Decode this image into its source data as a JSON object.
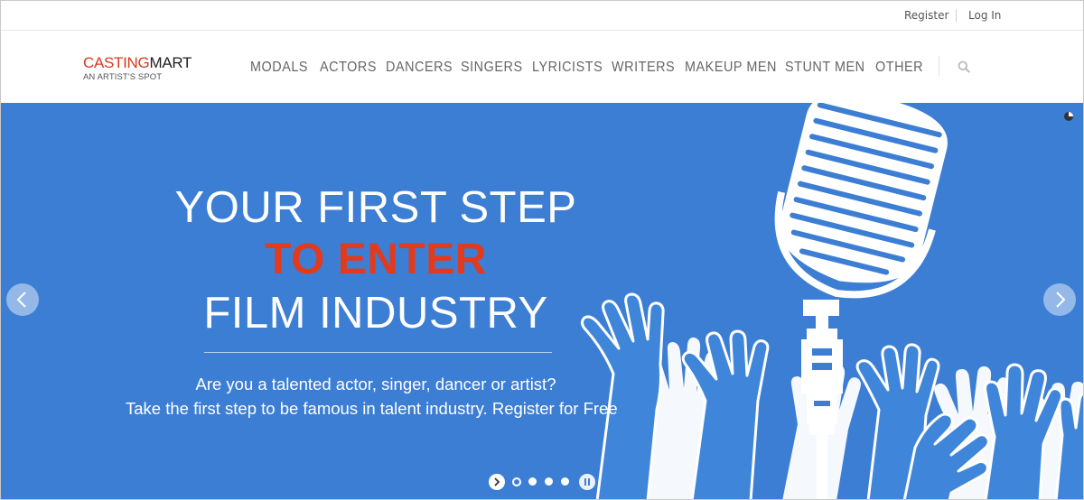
{
  "topbar": {
    "register_label": "Register",
    "login_label": "Log In"
  },
  "brand": {
    "name_part1": "CASTING",
    "name_part2": "MART",
    "tagline": "AN ARTIST'S SPOT",
    "accent_color": "#d9381e"
  },
  "nav": {
    "items": [
      {
        "label": "MODALS"
      },
      {
        "label": "ACTORS"
      },
      {
        "label": "DANCERS"
      },
      {
        "label": "SINGERS"
      },
      {
        "label": "LYRICISTS"
      },
      {
        "label": "WRITERS"
      },
      {
        "label": "MAKEUP MEN"
      },
      {
        "label": "STUNT MEN"
      },
      {
        "label": "OTHER"
      }
    ],
    "search_icon": "search-icon"
  },
  "hero": {
    "background_color": "#3c7ed4",
    "headline_line1": "YOUR FIRST STEP",
    "headline_line2": "TO ENTER",
    "headline_line3": "FILM INDUSTRY",
    "highlight_color": "#e03b1e",
    "subtext_line1": "Are you a talented actor, singer, dancer or artist?",
    "subtext_line2": "Take the first step to be famous in talent industry. Register for Free",
    "illustration": "microphone-with-raised-hands",
    "prev_icon": "chevron-left-icon",
    "next_icon": "chevron-right-icon",
    "slide_count": 4,
    "active_slide": 1
  }
}
